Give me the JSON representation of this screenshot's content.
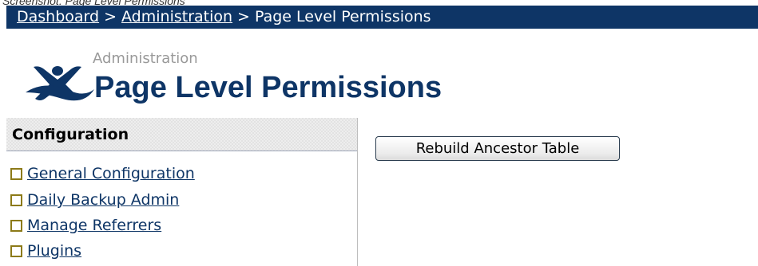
{
  "caption": "Screenshot: Page Level Permissions",
  "breadcrumb": {
    "items": [
      {
        "label": "Dashboard"
      },
      {
        "label": "Administration"
      }
    ],
    "separator": ">",
    "current": "Page Level Permissions"
  },
  "header": {
    "section": "Administration",
    "title": "Page Level Permissions",
    "logo_icon": "x-figure-logo"
  },
  "sidebar": {
    "heading": "Configuration",
    "items": [
      {
        "label": "General Configuration"
      },
      {
        "label": "Daily Backup Admin"
      },
      {
        "label": "Manage Referrers"
      },
      {
        "label": "Plugins"
      }
    ]
  },
  "main": {
    "rebuild_button_label": "Rebuild Ancestor Table"
  },
  "colors": {
    "nav_bar": "#0e3566",
    "title": "#0e3566",
    "link": "#0e3566",
    "bullet_border": "#8c7a18"
  }
}
